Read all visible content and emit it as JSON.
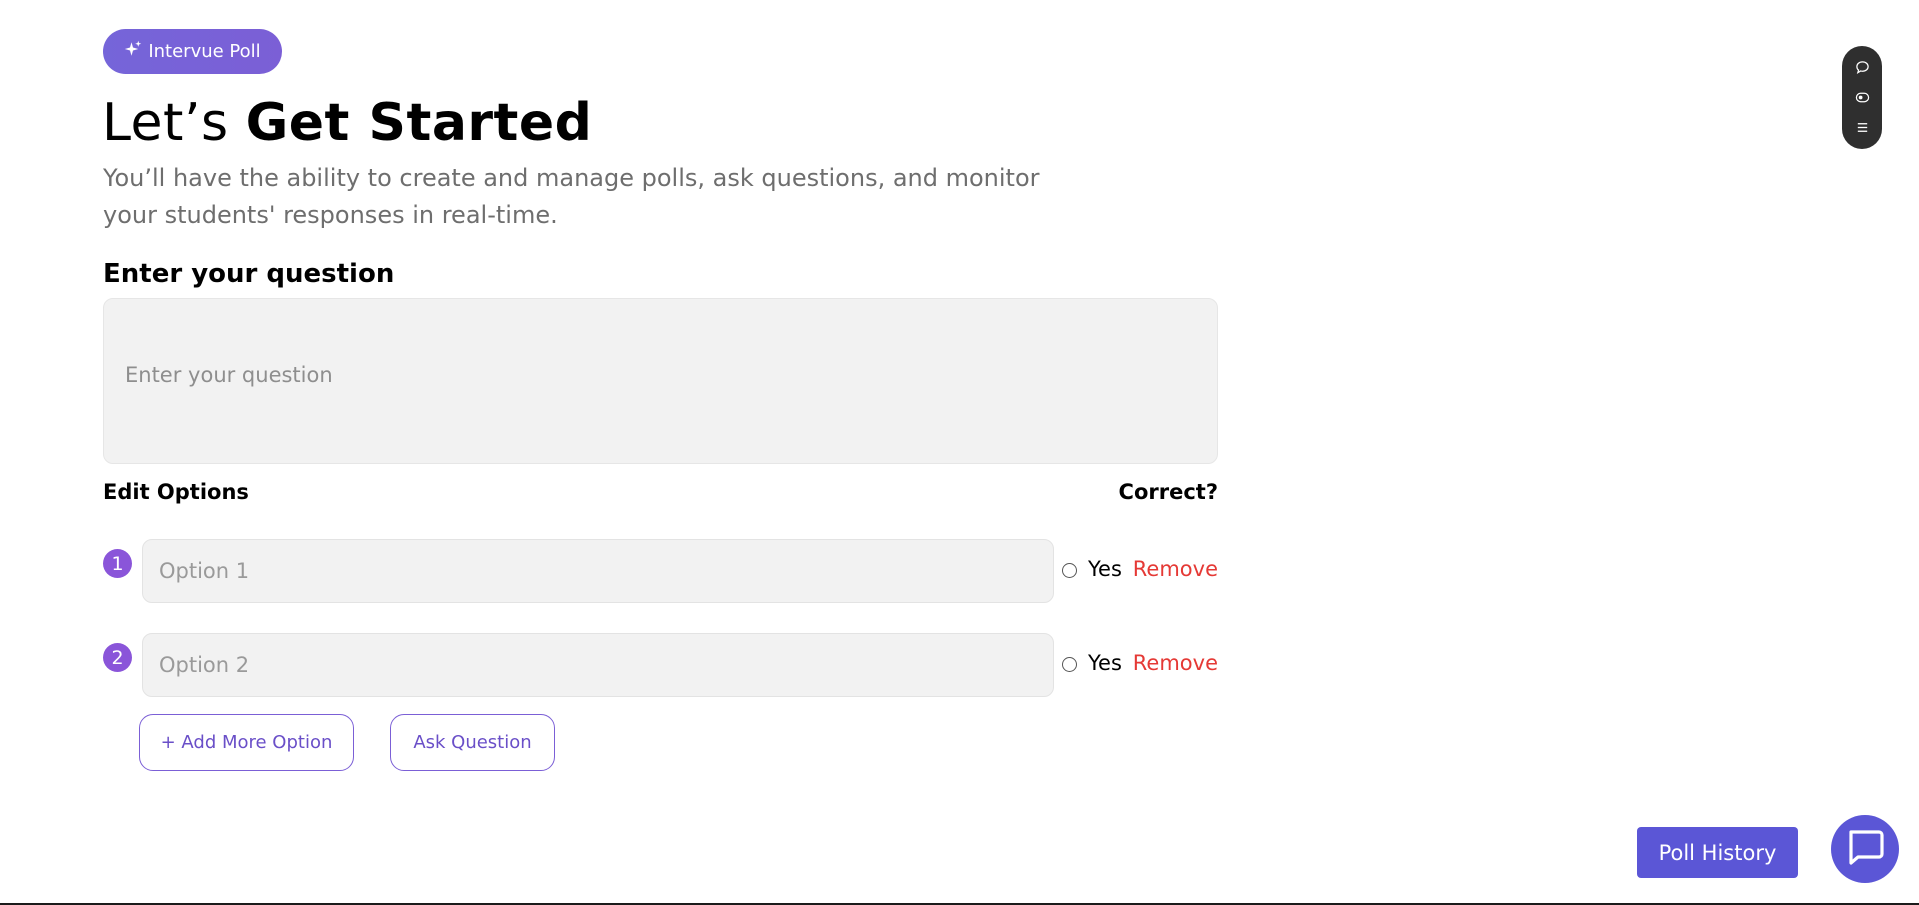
{
  "badge": {
    "label": "Intervue Poll",
    "icon": "sparkle-icon"
  },
  "header": {
    "title_light": "Let’s ",
    "title_bold": "Get Started",
    "subtitle": "You’ll have the ability to create and manage polls, ask questions, and monitor your students' responses in real-time."
  },
  "question": {
    "label": "Enter your question",
    "placeholder": "Enter your question",
    "value": ""
  },
  "options_header": {
    "edit_label": "Edit Options",
    "correct_label": "Correct?"
  },
  "options": [
    {
      "number": "1",
      "placeholder": "Option 1",
      "correct_label": "Yes",
      "remove_label": "Remove",
      "checked": false
    },
    {
      "number": "2",
      "placeholder": "Option 2",
      "correct_label": "Yes",
      "remove_label": "Remove",
      "checked": false
    }
  ],
  "actions": {
    "add_option_label": "+ Add More Option",
    "ask_question_label": "Ask Question"
  },
  "side_toolbar": {
    "icons": [
      "chat-bubble-icon",
      "eye-icon",
      "menu-icon"
    ]
  },
  "footer": {
    "poll_history_label": "Poll History",
    "chat_icon": "chat-icon"
  },
  "colors": {
    "primary": "#7765DA",
    "button_blue": "#5B56D6",
    "remove_red": "#E53935",
    "number_badge": "#8A55D9"
  }
}
